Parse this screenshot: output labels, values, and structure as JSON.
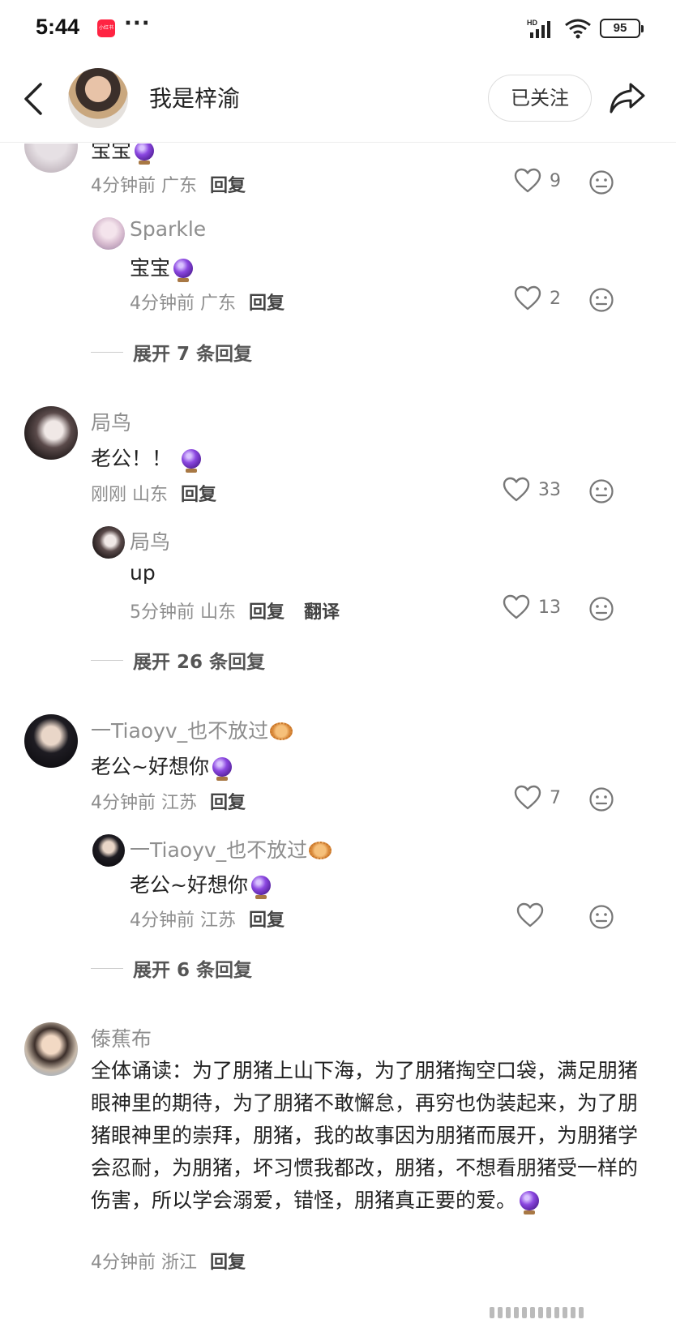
{
  "status_bar": {
    "time": "5:44",
    "app_badge": "小红书",
    "more": "···",
    "network": "HD",
    "battery": "95"
  },
  "header": {
    "username": "我是梓渝",
    "follow_label": "已关注"
  },
  "comments": [
    {
      "text": "宝宝",
      "time": "4分钟前",
      "location": "广东",
      "reply_label": "回复",
      "likes": "9",
      "replies": [
        {
          "name": "Sparkle",
          "text": "宝宝",
          "time": "4分钟前",
          "location": "广东",
          "reply_label": "回复",
          "likes": "2"
        }
      ],
      "expand_label": "展开 7 条回复"
    },
    {
      "name": "局鸟",
      "text": "老公！！",
      "time": "刚刚",
      "location": "山东",
      "reply_label": "回复",
      "likes": "33",
      "replies": [
        {
          "name": "局鸟",
          "text": "up",
          "time": "5分钟前",
          "location": "山东",
          "reply_label": "回复",
          "translate_label": "翻译",
          "likes": "13"
        }
      ],
      "expand_label": "展开 26 条回复"
    },
    {
      "name": "一Tiaoyv_也不放过",
      "text": "老公~好想你",
      "time": "4分钟前",
      "location": "江苏",
      "reply_label": "回复",
      "likes": "7",
      "replies": [
        {
          "name": "一Tiaoyv_也不放过",
          "text": "老公~好想你",
          "time": "4分钟前",
          "location": "江苏",
          "reply_label": "回复",
          "likes": ""
        }
      ],
      "expand_label": "展开 6 条回复"
    },
    {
      "name": "傣蕉布",
      "text": "全体诵读：为了朋猪上山下海，为了朋猪掏空口袋，满足朋猪眼神里的期待，为了朋猪不敢懈怠，再穷也伪装起来，为了朋猪眼神里的崇拜，朋猪，我的故事因为朋猪而展开，为朋猪学会忍耐，为朋猪，坏习惯我都改，朋猪，不想看朋猪受一样的伤害，所以学会溺爱，错怪，朋猪真正要的爱。",
      "time": "4分钟前",
      "location": "浙江",
      "reply_label": "回复"
    }
  ],
  "icons": {
    "back": "chevron-left-icon",
    "share": "share-arrow-icon",
    "like": "heart-outline-icon",
    "dislike": "neutral-face-icon",
    "emoji_orb": "crystal-ball-emoji",
    "emoji_fish": "pufferfish-emoji"
  },
  "colors": {
    "meta_gray": "#8e8e8e",
    "text": "#222222",
    "badge_red": "#ff2442"
  }
}
